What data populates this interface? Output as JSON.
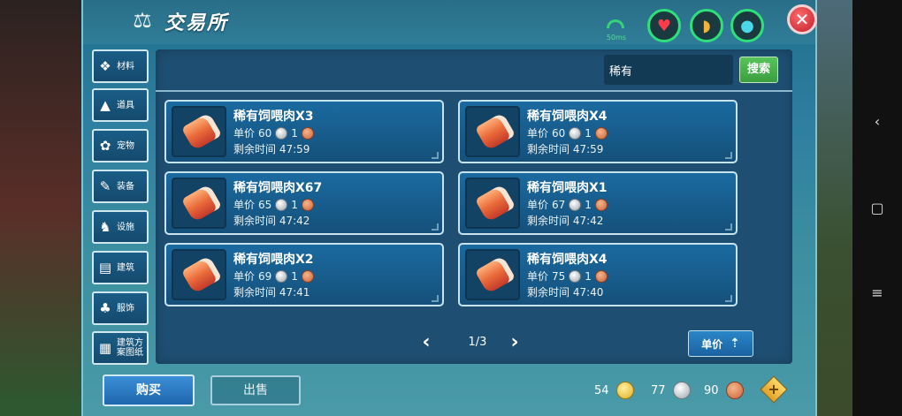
{
  "header": {
    "title": "交易所",
    "title_icon": "scales-icon",
    "ping": "50ms",
    "stats": [
      "heart-icon",
      "stomach-icon",
      "water-drop-icon"
    ],
    "close_icon": "close-icon"
  },
  "categories": [
    {
      "label": "材料",
      "icon": "material-icon"
    },
    {
      "label": "道具",
      "icon": "item-icon"
    },
    {
      "label": "宠物",
      "icon": "paw-icon"
    },
    {
      "label": "装备",
      "icon": "equipment-icon"
    },
    {
      "label": "设施",
      "icon": "facility-icon"
    },
    {
      "label": "建筑",
      "icon": "building-icon"
    },
    {
      "label": "服饰",
      "icon": "clothing-icon"
    },
    {
      "label": "建筑方\n案图纸",
      "icon": "blueprint-icon"
    }
  ],
  "search": {
    "value": "稀有",
    "button_label": "搜索"
  },
  "listings": [
    {
      "name": "稀有饲喂肉X3",
      "price_label": "单价",
      "silver": "60",
      "copper": "1",
      "time_label": "剩余时间",
      "time": "47:59"
    },
    {
      "name": "稀有饲喂肉X4",
      "price_label": "单价",
      "silver": "60",
      "copper": "1",
      "time_label": "剩余时间",
      "time": "47:59"
    },
    {
      "name": "稀有饲喂肉X67",
      "price_label": "单价",
      "silver": "65",
      "copper": "1",
      "time_label": "剩余时间",
      "time": "47:42"
    },
    {
      "name": "稀有饲喂肉X1",
      "price_label": "单价",
      "silver": "67",
      "copper": "1",
      "time_label": "剩余时间",
      "time": "47:42"
    },
    {
      "name": "稀有饲喂肉X2",
      "price_label": "单价",
      "silver": "69",
      "copper": "1",
      "time_label": "剩余时间",
      "time": "47:41"
    },
    {
      "name": "稀有饲喂肉X4",
      "price_label": "单价",
      "silver": "75",
      "copper": "1",
      "time_label": "剩余时间",
      "time": "47:40"
    }
  ],
  "pagination": {
    "indicator": "1/3",
    "prev_icon": "chevron-left-icon",
    "next_icon": "chevron-right-icon"
  },
  "sort": {
    "label": "单价",
    "icon": "sort-arrow-icon"
  },
  "footer": {
    "buy_label": "购买",
    "sell_label": "出售",
    "gold": "54",
    "silver": "77",
    "copper": "90",
    "add_icon": "plus-icon"
  }
}
